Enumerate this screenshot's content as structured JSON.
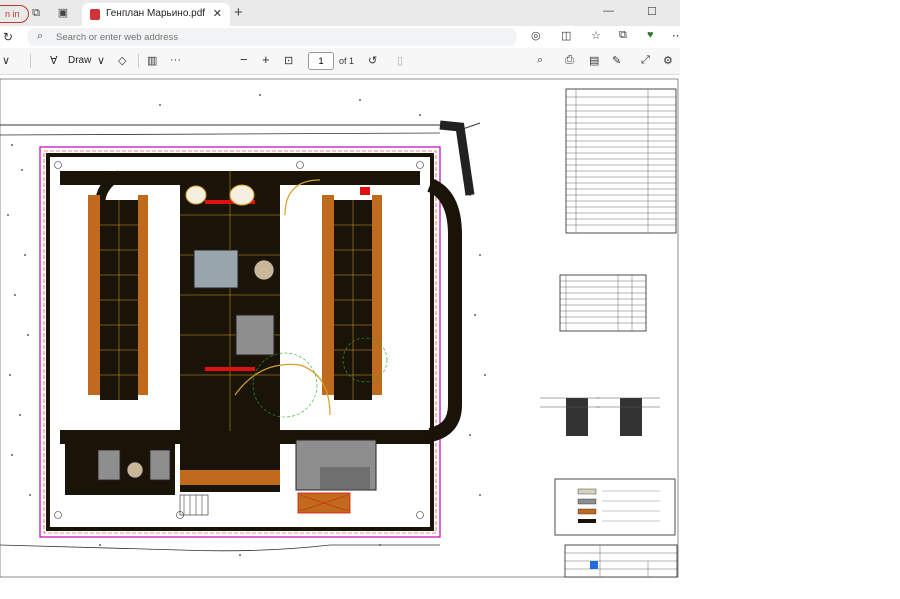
{
  "browser": {
    "signin_label": "n in",
    "tab_title": "Генплан Марьино.pdf",
    "tab_close": "✕",
    "new_tab": "+",
    "address_placeholder": "Search or enter web address"
  },
  "pdf_toolbar": {
    "draw_label": "Draw",
    "more": "···",
    "zoom_out": "−",
    "zoom_in": "+",
    "page_number": "1",
    "page_of": "of 1"
  },
  "colors": {
    "road": "#1a1308",
    "building": "#c06a1e",
    "fence": "#c000c0",
    "accent_red": "#e01010"
  }
}
